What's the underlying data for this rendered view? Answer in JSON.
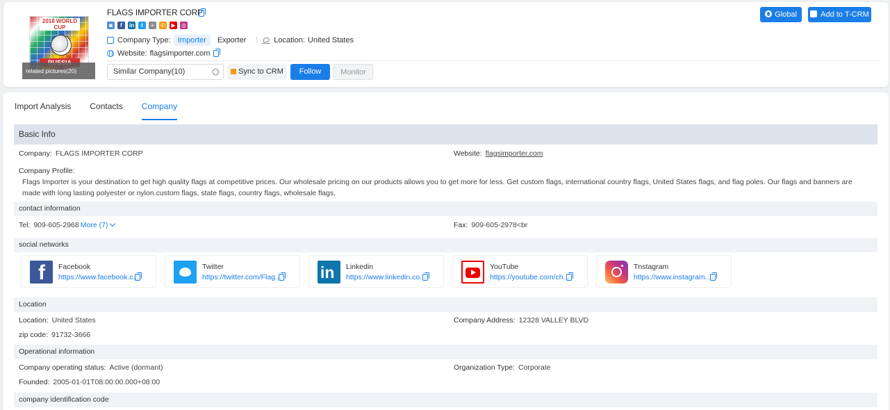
{
  "header": {
    "company_name": "FLAGS IMPORTER CORP",
    "thumbnail_label": "related pictures(20)",
    "thumb_banner": "2018 WORLD CUP",
    "thumb_russia": "RUSSIA",
    "company_type_label": "Company Type:",
    "type_importer": "Importer",
    "type_exporter": "Exporter",
    "location_label": "Location:",
    "location_value": "United States",
    "website_label": "Website:",
    "website_value": "flagsimporter.com",
    "similar_company": "Similar Company(10)",
    "sync_label": "Sync to CRM",
    "follow_label": "Follow",
    "monitor_label": "Monitor",
    "global_label": "Global",
    "tcrm_label": "Add to T-CRM",
    "mini_icons": [
      {
        "icon": "web-icon",
        "color": "#4a90d9",
        "glyph": "◙"
      },
      {
        "icon": "facebook-icon",
        "color": "#3b5998",
        "glyph": "f"
      },
      {
        "icon": "linkedin-icon",
        "color": "#0e76a8",
        "glyph": "in"
      },
      {
        "icon": "twitter-icon",
        "color": "#1da1f2",
        "glyph": "t"
      },
      {
        "icon": "document-icon",
        "color": "#8a8a8a",
        "glyph": "≡"
      },
      {
        "icon": "phone-icon",
        "color": "#f39c12",
        "glyph": "✆"
      },
      {
        "icon": "youtube-icon",
        "color": "#e00000",
        "glyph": "▶"
      },
      {
        "icon": "instagram-icon",
        "color": "#c13584",
        "glyph": "◎"
      }
    ]
  },
  "tabs": [
    {
      "label": "Import Analysis"
    },
    {
      "label": "Contacts"
    },
    {
      "label": "Company",
      "active": true
    }
  ],
  "basic_info": {
    "title": "Basic Info",
    "company_label": "Company:",
    "company_value": "FLAGS IMPORTER CORP",
    "website_label": "Website:",
    "website_value": "flagsimporter.com",
    "profile_label": "Company Profile:",
    "profile_text": "Flags Importer is your destination to get high quality flags at competitive prices. Our wholesale pricing on our products allows you to get more for less. Get custom flags, international country flags, United States flags, and flag poles. Our flags and banners are made with long lasting polyester or nylon.custom flags, state flags, country flags, wholesale flags,"
  },
  "contact": {
    "title": "contact information",
    "tel_label": "Tel:",
    "tel_value": "909-605-2968",
    "more_label": "More (7)",
    "fax_label": "Fax:",
    "fax_value": "909-605-2978<br"
  },
  "social": {
    "title": "social networks",
    "items": [
      {
        "name": "Facebook",
        "url": "https://www.facebook.c..."
      },
      {
        "name": "Twitter",
        "url": "https://twitter.com/Flag..."
      },
      {
        "name": "Linkedin",
        "url": "https://www.linkedin.co..."
      },
      {
        "name": "YouTube",
        "url": "https://youtube.com/ch..."
      },
      {
        "name": "Tnstagram",
        "url": "https://www.instagram...."
      }
    ]
  },
  "location": {
    "title": "Location",
    "location_label": "Location:",
    "location_value": "United States",
    "address_label": "Company Address:",
    "address_value": "12328 VALLEY BLVD",
    "zip_label": "zip code:",
    "zip_value": "91732-3666"
  },
  "operational": {
    "title": "Operational information",
    "status_label": "Company operating status:",
    "status_value": "Active (dormant)",
    "org_label": "Organization Type:",
    "org_value": "Corporate",
    "founded_label": "Founded:",
    "founded_value": "2005-01-01T08:00:00.000+08:00"
  },
  "identification": {
    "title": "company identification code"
  }
}
